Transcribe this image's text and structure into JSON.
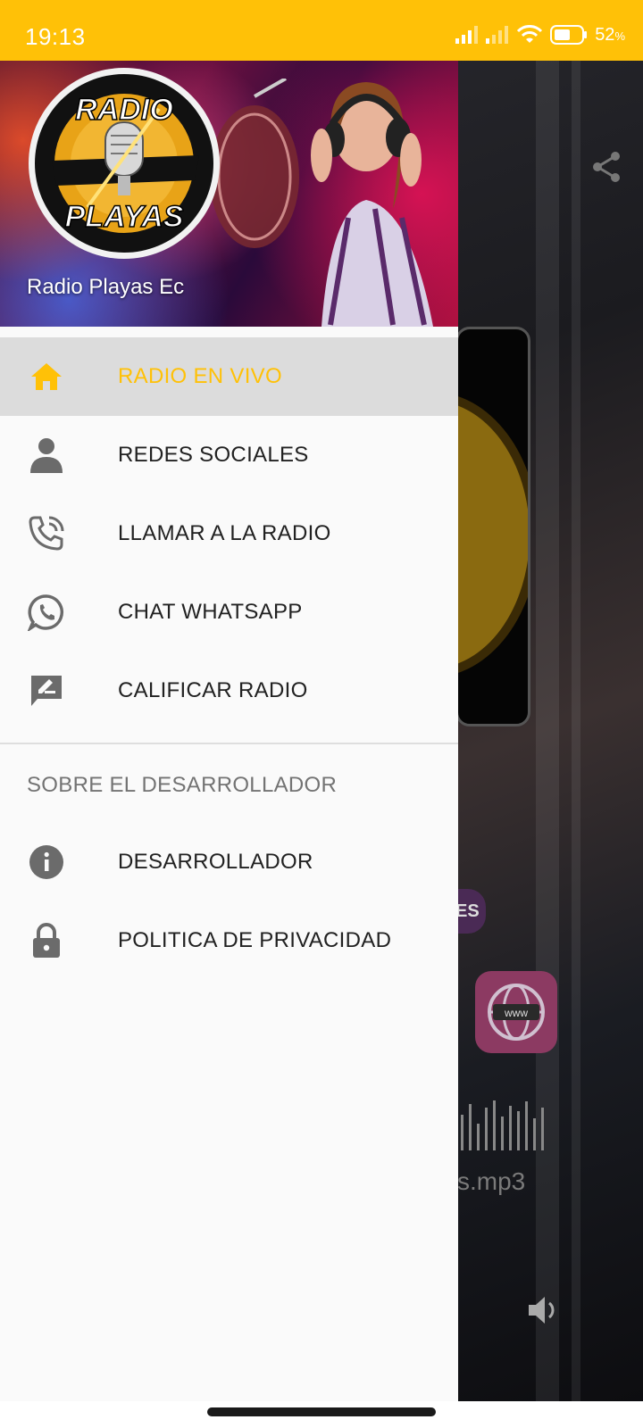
{
  "status_bar": {
    "time": "19:13",
    "battery": "52",
    "battery_unit": "%"
  },
  "drawer": {
    "header": {
      "title": "Radio Playas Ec",
      "logo": {
        "line1": "RADIO",
        "line2": "PLAYAS"
      }
    },
    "items": [
      {
        "label": "RADIO EN VIVO",
        "icon": "home-icon",
        "active": true
      },
      {
        "label": "REDES SOCIALES",
        "icon": "person-icon",
        "active": false
      },
      {
        "label": "LLAMAR A LA RADIO",
        "icon": "phone-icon",
        "active": false
      },
      {
        "label": "CHAT WHATSAPP",
        "icon": "whatsapp-icon",
        "active": false
      },
      {
        "label": "CALIFICAR RADIO",
        "icon": "rate-review-icon",
        "active": false
      }
    ],
    "section_header": "SOBRE EL DESARROLLADOR",
    "section_items": [
      {
        "label": "DESARROLLADOR",
        "icon": "info-icon"
      },
      {
        "label": "POLITICA DE PRIVACIDAD",
        "icon": "lock-icon"
      }
    ]
  },
  "background": {
    "chip_text": "ES",
    "web_button_text": "www",
    "stream_file": "s.mp3"
  },
  "colors": {
    "accent": "#FFC107",
    "active_row": "#dcdcdc",
    "icon_gray": "#6b6b6b"
  }
}
